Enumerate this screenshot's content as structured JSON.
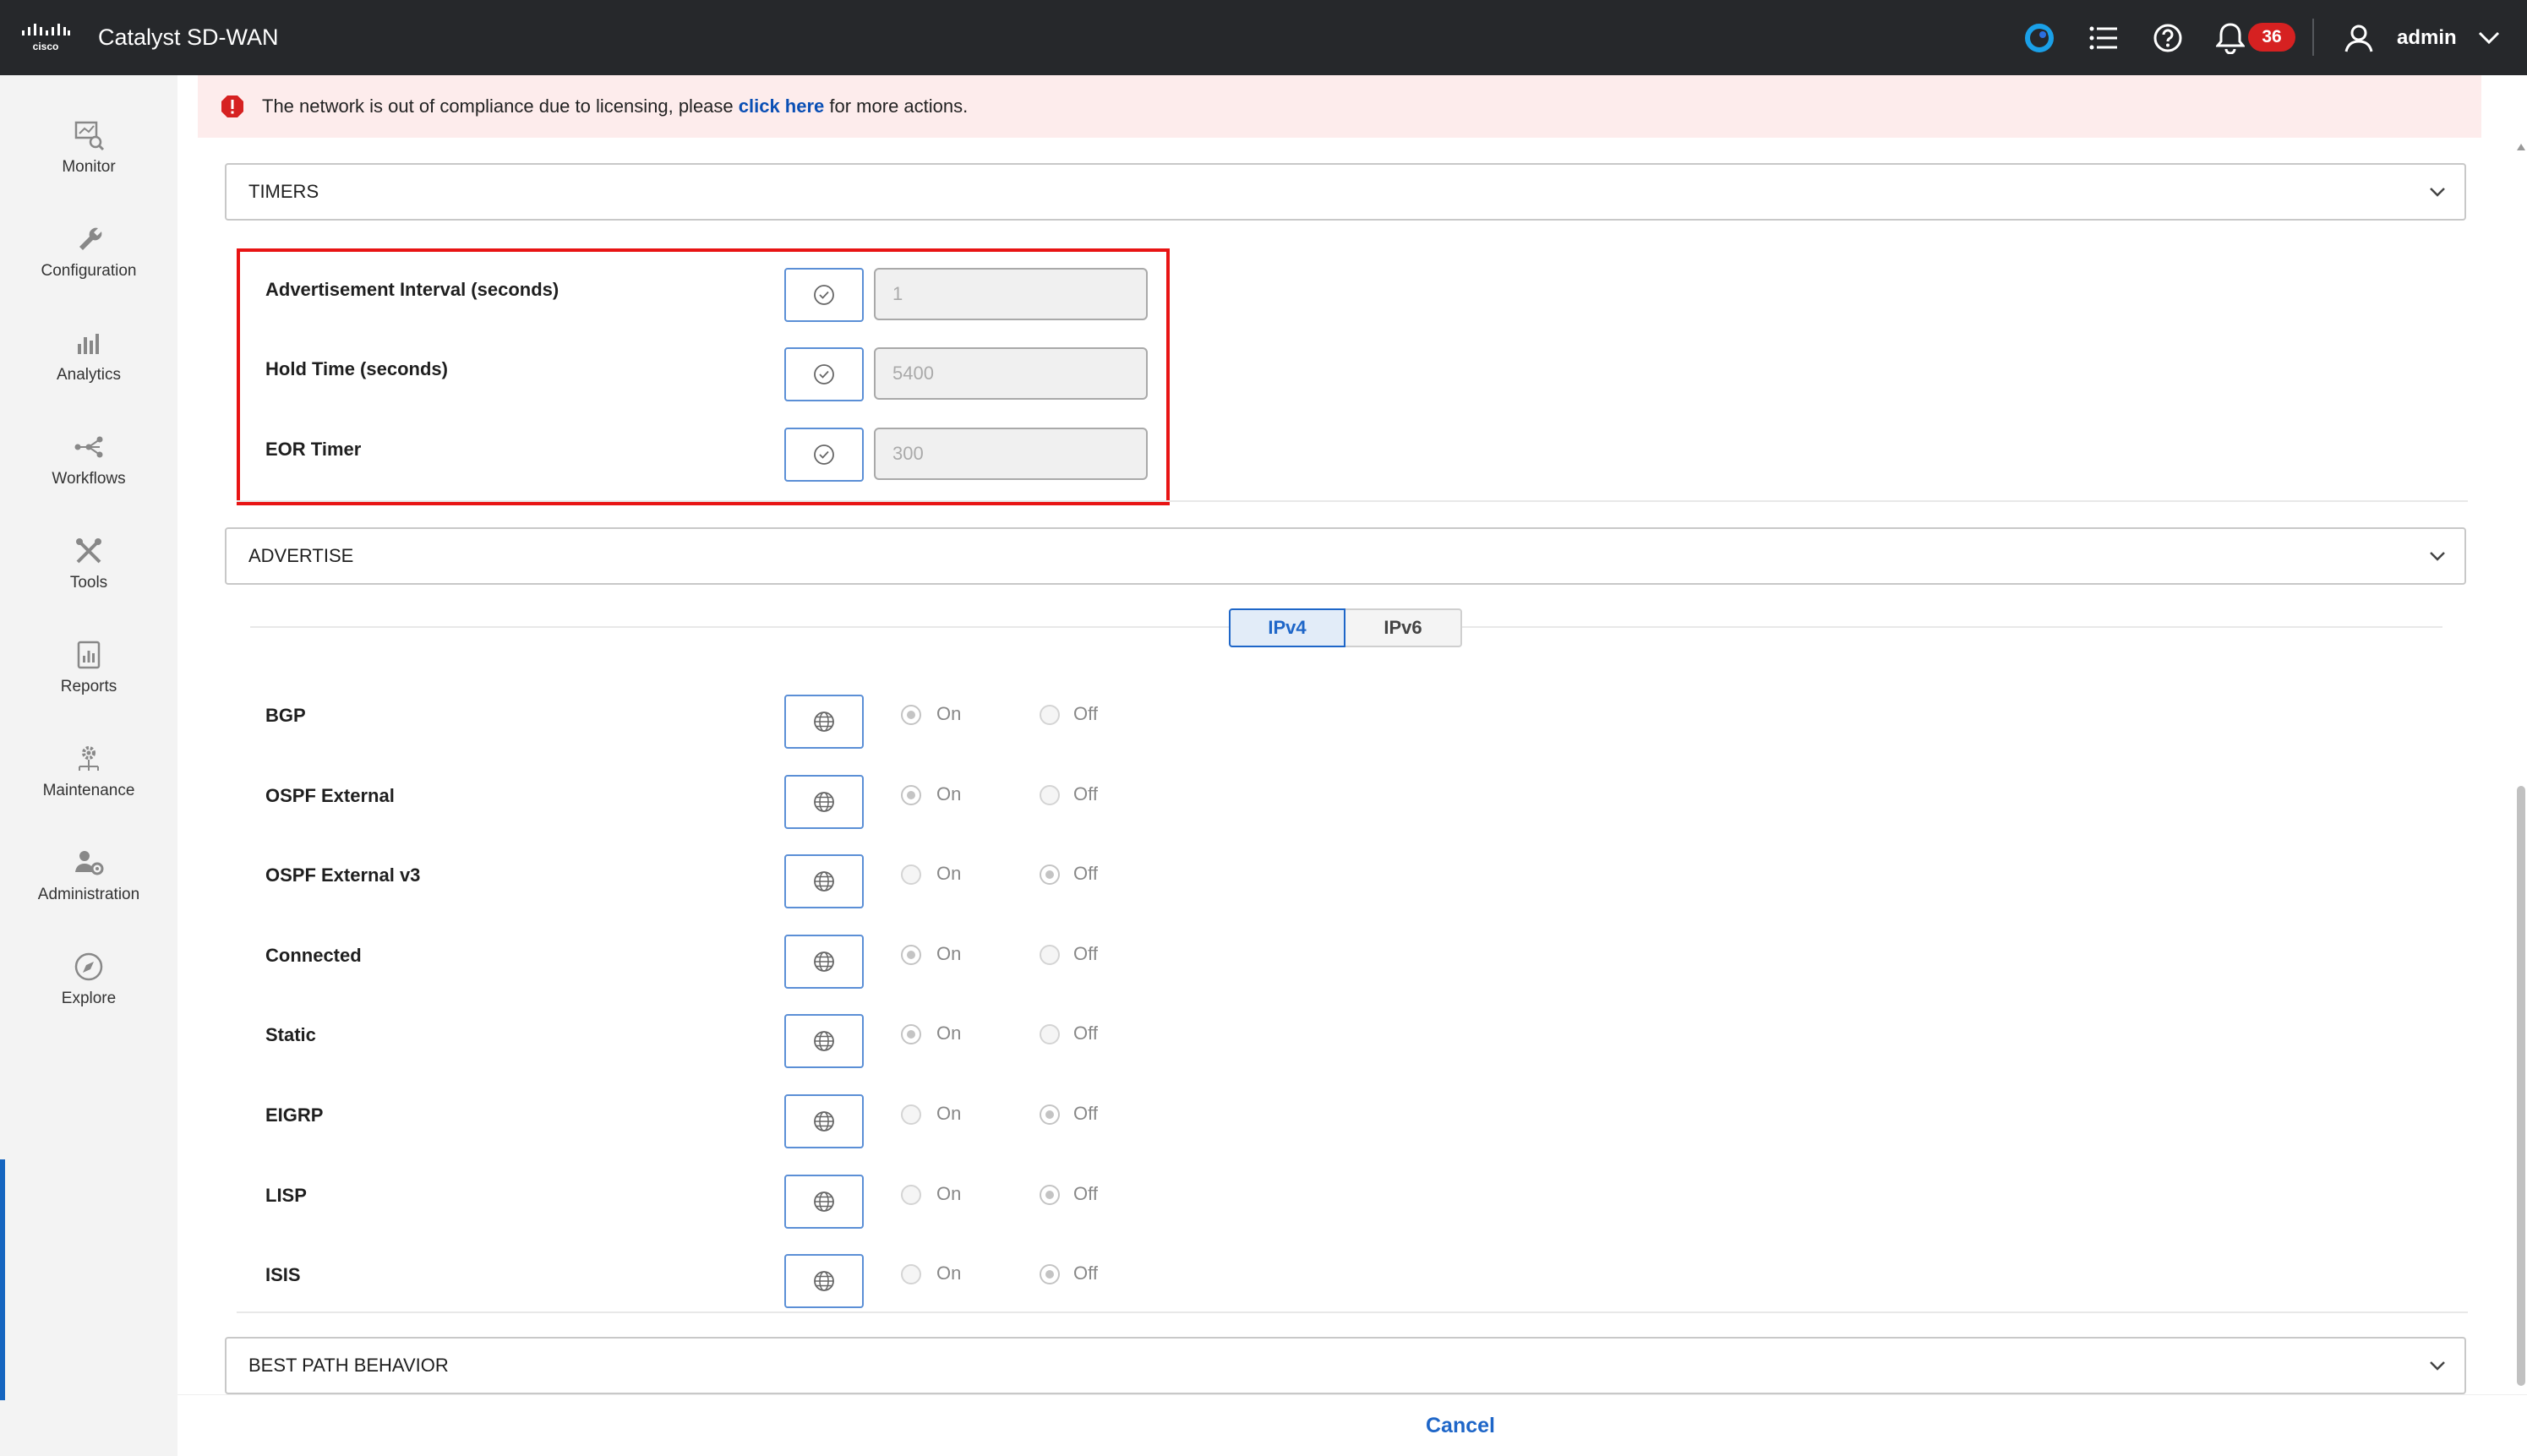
{
  "app": {
    "title": "Catalyst SD-WAN",
    "logo_text": "cisco",
    "notification_count": "36",
    "user": "admin"
  },
  "sidebar": {
    "items": [
      {
        "label": "Monitor",
        "icon": "monitor-icon"
      },
      {
        "label": "Configuration",
        "icon": "wrench-icon"
      },
      {
        "label": "Analytics",
        "icon": "bar-chart-icon"
      },
      {
        "label": "Workflows",
        "icon": "workflow-icon"
      },
      {
        "label": "Tools",
        "icon": "tools-icon"
      },
      {
        "label": "Reports",
        "icon": "report-icon"
      },
      {
        "label": "Maintenance",
        "icon": "maintenance-icon"
      },
      {
        "label": "Administration",
        "icon": "admin-user-icon"
      },
      {
        "label": "Explore",
        "icon": "compass-icon"
      }
    ]
  },
  "banner": {
    "prefix": "The network is out of compliance due to licensing, please ",
    "link": "click here",
    "suffix": " for more actions."
  },
  "timers": {
    "title": "TIMERS",
    "rows": [
      {
        "label": "Advertisement Interval (seconds)",
        "value": "1"
      },
      {
        "label": "Hold Time (seconds)",
        "value": "5400"
      },
      {
        "label": "EOR Timer",
        "value": "300"
      }
    ]
  },
  "advertise": {
    "title": "ADVERTISE",
    "tabs": [
      "IPv4",
      "IPv6"
    ],
    "active_tab": "IPv4",
    "on_label": "On",
    "off_label": "Off",
    "rows": [
      {
        "label": "BGP",
        "selected": "On"
      },
      {
        "label": "OSPF External",
        "selected": "On"
      },
      {
        "label": "OSPF External v3",
        "selected": "Off"
      },
      {
        "label": "Connected",
        "selected": "On"
      },
      {
        "label": "Static",
        "selected": "On"
      },
      {
        "label": "EIGRP",
        "selected": "Off"
      },
      {
        "label": "LISP",
        "selected": "Off"
      },
      {
        "label": "ISIS",
        "selected": "Off"
      }
    ]
  },
  "best_path": {
    "title": "BEST PATH BEHAVIOR"
  },
  "footer": {
    "cancel_label": "Cancel"
  },
  "colors": {
    "topbar": "#26282b",
    "accent": "#1e66c8",
    "highlight": "#e81414",
    "badge": "#d62121",
    "banner": "#fdecec"
  }
}
